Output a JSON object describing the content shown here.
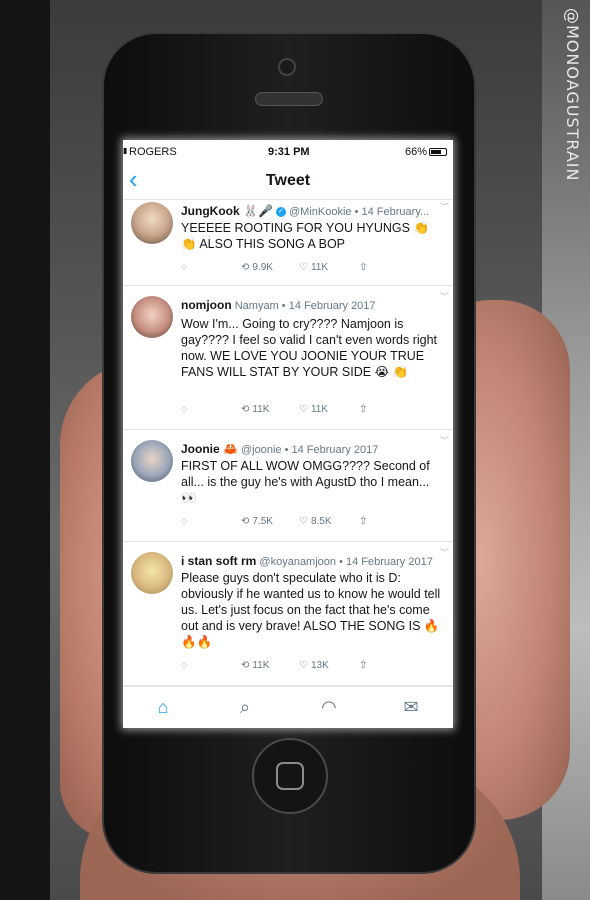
{
  "watermark": "@MONOAGUSTRAIN",
  "status": {
    "carrier": "ROGERS",
    "time": "9:31 PM",
    "battery": "66%"
  },
  "nav": {
    "back": "‹",
    "title": "Tweet"
  },
  "tweets": [
    {
      "name": "JungKook 🐰🎤",
      "handle": "@MinKookie",
      "date": "14 February...",
      "verified": true,
      "text": "YEEEEE ROOTING FOR YOU HYUNGS 👏 👏 ALSO THIS SONG A BOP",
      "retweets": "9.9K",
      "likes": "11K"
    },
    {
      "name": "nomjoon",
      "handle": "Namyam",
      "date": "14 February 2017",
      "text": "Wow I'm... Going to cry???? Namjoon is gay???? I feel so valid I can't even words right now. WE LOVE YOU JOONIE YOUR TRUE FANS WILL STAT BY YOUR SIDE 😭 👏",
      "retweets": "11K",
      "likes": "11K"
    },
    {
      "name": "Joonie 🦀",
      "handle": "@joonie",
      "date": "14 February 2017",
      "text": "FIRST OF ALL WOW OMGG???? Second of all... is the guy he's with AgustD tho I mean... 👀",
      "retweets": "7.5K",
      "likes": "8.5K"
    },
    {
      "name": "i stan soft rm",
      "handle": "@koyanamjoon",
      "date": "14 February 2017",
      "text": "Please guys don't speculate who it is D: obviously if he wanted us to know he would tell us. Let's just focus on the fact that he's come out and is very brave! ALSO THE SONG IS 🔥🔥🔥",
      "retweets": "11K",
      "likes": "13K"
    }
  ],
  "icons": {
    "reply": "💬",
    "retweet": "⟲",
    "like": "♡",
    "share": "⇧",
    "home": "⌂",
    "search": "⌕",
    "notifications": "🔔",
    "messages": "✉"
  },
  "colors": {
    "accent": "#1da1f2",
    "text": "#14171a",
    "muted": "#657786"
  }
}
